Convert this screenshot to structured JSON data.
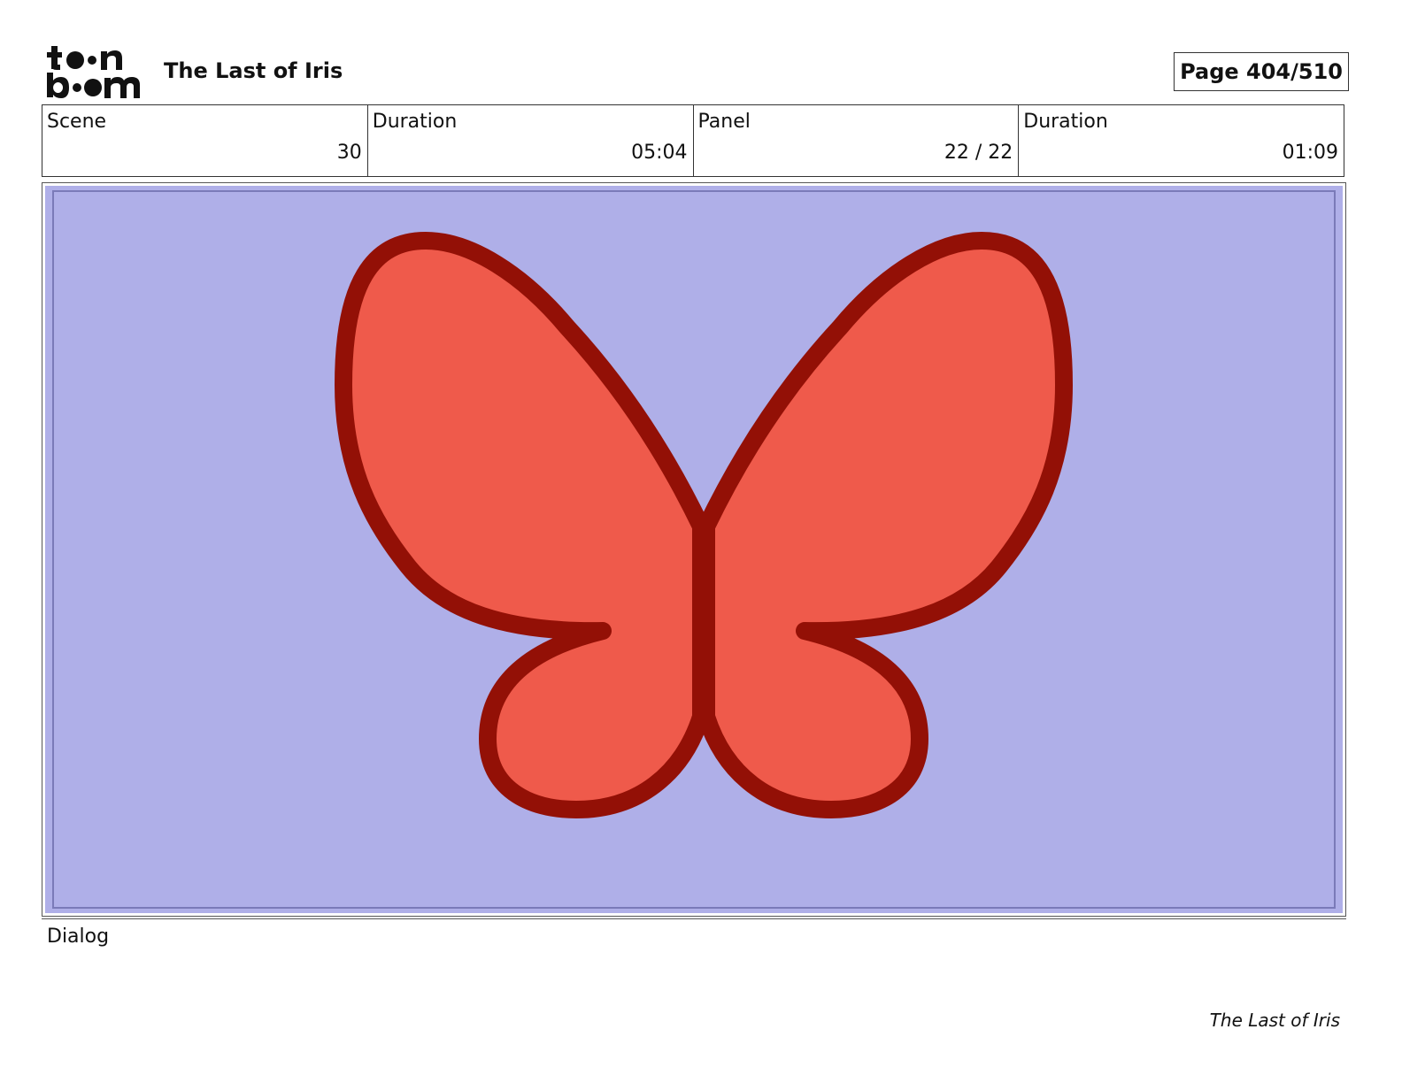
{
  "header": {
    "logo_text": "toon boom",
    "project_title": "The Last of Iris",
    "page_indicator": "Page 404/510"
  },
  "info_table": {
    "cells": [
      {
        "label": "Scene",
        "value": "30"
      },
      {
        "label": "Duration",
        "value": "05:04"
      },
      {
        "label": "Panel",
        "value": "22 / 22"
      },
      {
        "label": "Duration",
        "value": "01:09"
      }
    ]
  },
  "panel": {
    "background_color": "#afafe8",
    "subject": "butterfly-icon",
    "wing_fill": "#ef5a4b",
    "wing_outline": "#931006"
  },
  "dialog": {
    "label": "Dialog",
    "text": ""
  },
  "footer": {
    "title": "The Last of Iris"
  }
}
